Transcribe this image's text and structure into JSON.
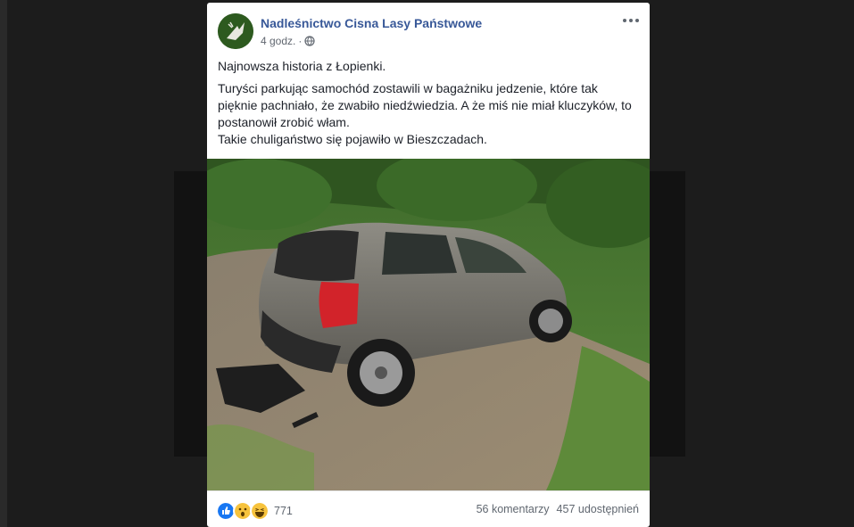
{
  "post": {
    "page_name": "Nadleśnictwo Cisna Lasy Państwowe",
    "time": "4 godz.",
    "privacy_icon": "globe-icon",
    "paragraphs": [
      "Najnowsza historia z Łopienki.",
      "Turyści parkując samochód zostawili w bagażniku jedzenie, które tak\npięknie pachniało, że zwabiło niedźwiedzia. A że miś nie miał kluczyków, to\npostanowił zrobić włam.\nTakie chuligaństwo się pojawiło w Bieszczadach."
    ]
  },
  "reactions": {
    "icons": [
      "like-icon",
      "wow-icon",
      "haha-icon"
    ],
    "count": "771"
  },
  "stats": {
    "comments": "56 komentarzy",
    "shares": "457 udostępnień"
  },
  "colors": {
    "link_blue": "#385898",
    "like_blue": "#1877f2",
    "emoji_yellow": "#f7c33d"
  }
}
